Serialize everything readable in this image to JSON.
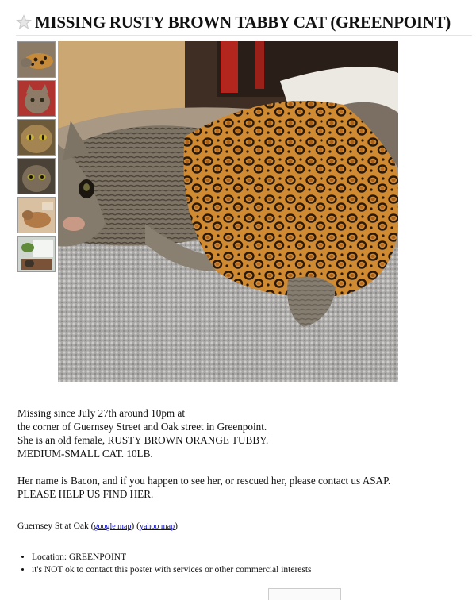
{
  "posting": {
    "title": "MISSING RUSTY BROWN TABBY CAT (GREENPOINT)",
    "star_icon": "star-icon"
  },
  "gallery": {
    "thumbnail_count": 6,
    "thumbnails": [
      {
        "label": "thumbnail 1"
      },
      {
        "label": "thumbnail 2"
      },
      {
        "label": "thumbnail 3"
      },
      {
        "label": "thumbnail 4"
      },
      {
        "label": "thumbnail 5"
      },
      {
        "label": "thumbnail 6"
      }
    ]
  },
  "body": {
    "lines": [
      "Missing since July 27th around 10pm at",
      "the corner of Guernsey Street and Oak street in Greenpoint.",
      "She is an old female, RUSTY BROWN ORANGE TUBBY.",
      "MEDIUM-SMALL CAT. 10LB.",
      "",
      "Her name is Bacon, and if you happen to see her, or rescued her, please contact us ASAP.",
      "PLEASE HELP US FIND HER."
    ]
  },
  "map": {
    "address": "Guernsey St at Oak",
    "google_link": "google map",
    "yahoo_link": "yahoo map"
  },
  "attributes": [
    "Location: GREENPOINT",
    "it's NOT ok to contact this poster with services or other commercial interests"
  ]
}
